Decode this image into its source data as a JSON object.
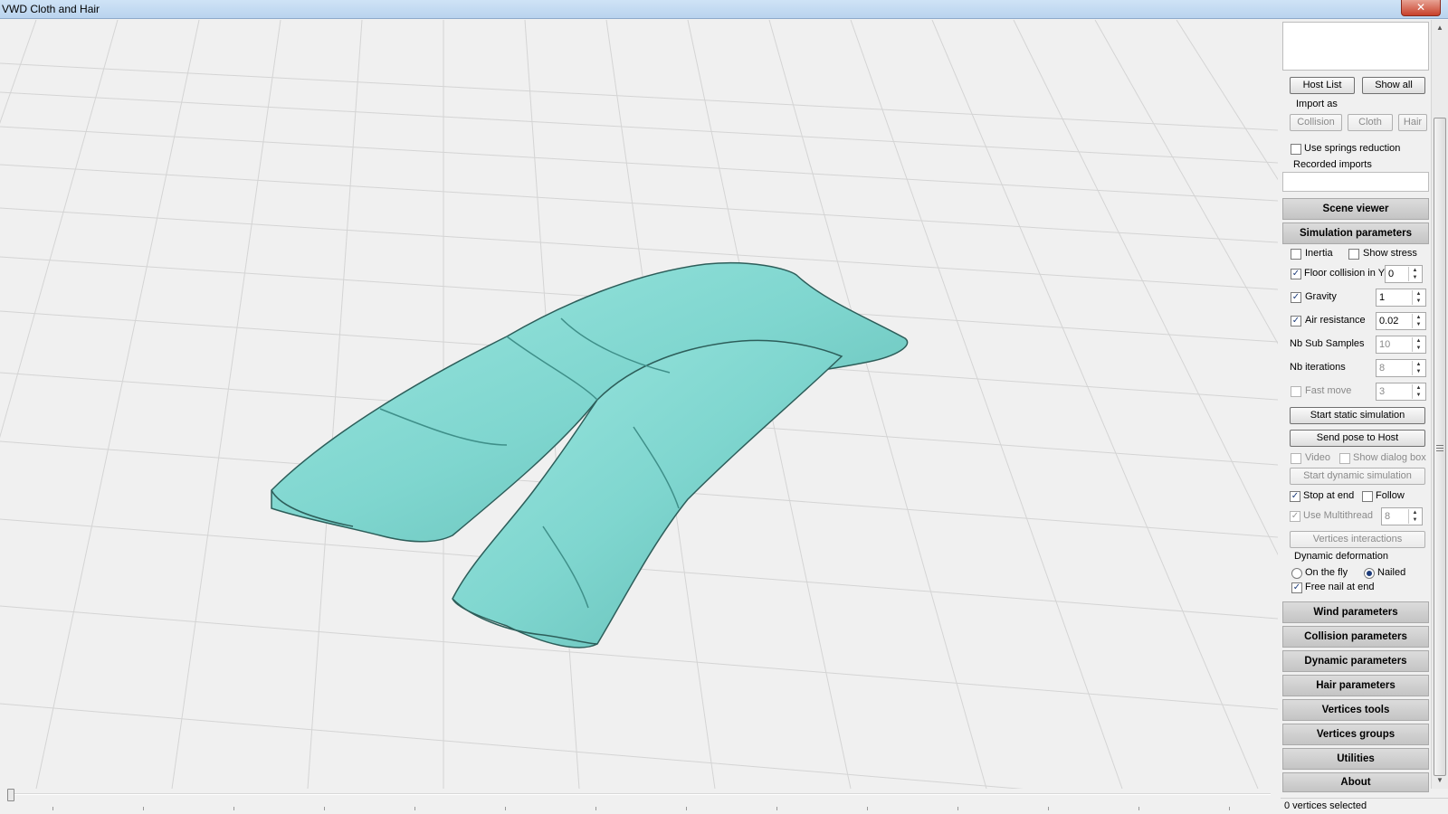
{
  "window": {
    "title": "VWD Cloth and Hair",
    "close_symbol": "✕"
  },
  "panel": {
    "host_list_label": "Host List",
    "show_all_label": "Show all",
    "import_as_label": "Import as",
    "import_collision_label": "Collision",
    "import_cloth_label": "Cloth",
    "import_hair_label": "Hair",
    "use_springs_reduction_label": "Use springs reduction",
    "recorded_imports_label": "Recorded imports",
    "scene_viewer_label": "Scene viewer",
    "simulation_parameters_label": "Simulation parameters",
    "sim": {
      "inertia_label": "Inertia",
      "show_stress_label": "Show stress",
      "floor_collision_label": "Floor collision in Y",
      "floor_collision_value": "0",
      "gravity_label": "Gravity",
      "gravity_value": "1",
      "air_resistance_label": "Air resistance",
      "air_resistance_value": "0.02",
      "nb_sub_samples_label": "Nb Sub Samples",
      "nb_sub_samples_value": "10",
      "nb_iterations_label": "Nb iterations",
      "nb_iterations_value": "8",
      "fast_move_label": "Fast move",
      "fast_move_value": "3",
      "start_static_label": "Start static simulation",
      "send_pose_label": "Send pose to Host",
      "video_label": "Video",
      "show_dialog_box_label": "Show dialog box",
      "start_dynamic_label": "Start dynamic simulation",
      "stop_at_end_label": "Stop at end",
      "follow_label": "Follow",
      "use_multithread_label": "Use Multithread",
      "multithread_value": "8",
      "vertices_interactions_label": "Vertices interactions",
      "dynamic_deformation_label": "Dynamic deformation",
      "on_the_fly_label": "On the fly",
      "nailed_label": "Nailed",
      "free_nail_label": "Free nail at end",
      "check_symbol": "✓"
    },
    "sections": {
      "wind": "Wind parameters",
      "collision": "Collision parameters",
      "dynamic": "Dynamic parameters",
      "hair": "Hair parameters",
      "vertices_tools": "Vertices tools",
      "vertices_groups": "Vertices groups",
      "utilities": "Utilities",
      "about": "About"
    }
  },
  "status": {
    "text": "0 vertices selected"
  },
  "colors": {
    "cloth": "#7fd6cf",
    "cloth_shadow": "#3f8f89",
    "grid": "#d2d2d2",
    "background": "#f0f0f0"
  }
}
